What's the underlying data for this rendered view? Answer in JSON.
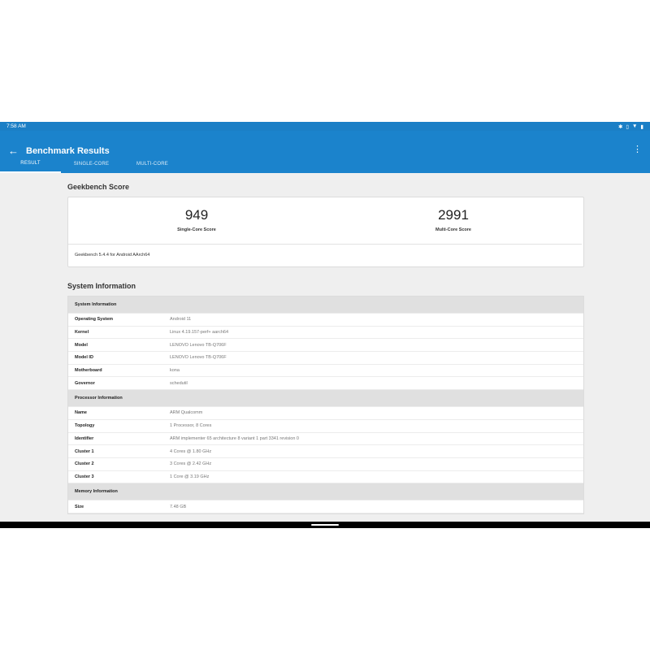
{
  "status_bar": {
    "time": "7:58 AM",
    "icons": [
      "bluetooth-icon",
      "vibrate-icon",
      "wifi-icon",
      "battery-icon"
    ]
  },
  "app_bar": {
    "title": "Benchmark Results",
    "back_icon": "arrow-left-icon",
    "more_icon": "more-vert-icon"
  },
  "tabs": [
    {
      "label": "RESULT",
      "active": true
    },
    {
      "label": "SINGLE-CORE",
      "active": false
    },
    {
      "label": "MULTI-CORE",
      "active": false
    }
  ],
  "geekbench": {
    "section_title": "Geekbench Score",
    "single": {
      "value": "949",
      "label": "Single-Core Score"
    },
    "multi": {
      "value": "2991",
      "label": "Multi-Core Score"
    },
    "version": "Geekbench 5.4.4 for Android AArch64"
  },
  "system_info": {
    "section_title": "System Information",
    "groups": [
      {
        "header": "System Information",
        "rows": [
          {
            "key": "Operating System",
            "value": "Android 11"
          },
          {
            "key": "Kernel",
            "value": "Linux 4.19.157-perf+ aarch64"
          },
          {
            "key": "Model",
            "value": "LENOVO Lenovo TB-Q706F"
          },
          {
            "key": "Model ID",
            "value": "LENOVO Lenovo TB-Q706F"
          },
          {
            "key": "Motherboard",
            "value": "kona"
          },
          {
            "key": "Governor",
            "value": "schedutil"
          }
        ]
      },
      {
        "header": "Processor Information",
        "rows": [
          {
            "key": "Name",
            "value": "ARM Qualcomm"
          },
          {
            "key": "Topology",
            "value": "1 Processor, 8 Cores"
          },
          {
            "key": "Identifier",
            "value": "ARM implementer 65 architecture 8 variant 1 part 3341 revision 0"
          },
          {
            "key": "Cluster 1",
            "value": "4 Cores @ 1.80 GHz"
          },
          {
            "key": "Cluster 2",
            "value": "3 Cores @ 2.42 GHz"
          },
          {
            "key": "Cluster 3",
            "value": "1 Core @ 3.19 GHz"
          }
        ]
      },
      {
        "header": "Memory Information",
        "rows": [
          {
            "key": "Size",
            "value": "7.48 GB"
          }
        ]
      }
    ]
  },
  "colors": {
    "app_bar": "#1b83cc",
    "background": "#efefef",
    "group_header": "#e0e0e0"
  }
}
